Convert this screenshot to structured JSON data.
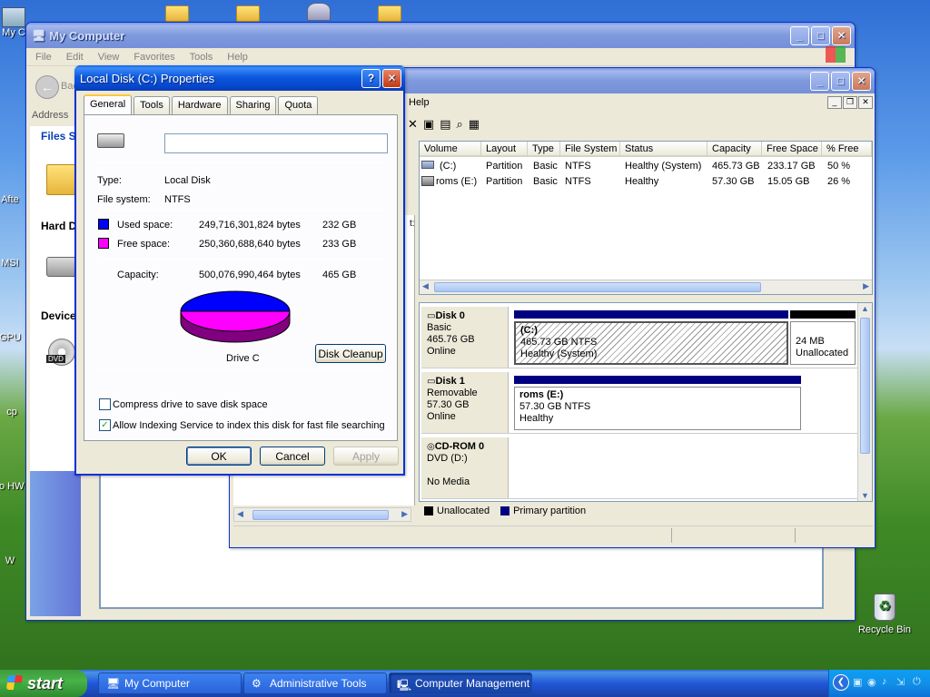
{
  "desktop": {
    "icons": [
      {
        "label": "My C",
        "name": "my-computer-icon"
      },
      {
        "label": "Afte",
        "name": "desktop-shortcut-icon"
      },
      {
        "label": "MSI",
        "name": "msi-icon"
      },
      {
        "label": "GPU",
        "name": "gpu-icon"
      },
      {
        "label": "cp",
        "name": "cp-icon"
      },
      {
        "label": "Sho HW",
        "name": "show-hw-icon"
      },
      {
        "label": "W",
        "name": "w-icon"
      }
    ],
    "recycle_bin": "Recycle Bin"
  },
  "my_computer": {
    "title": "My Computer",
    "menu": [
      "File",
      "Edit",
      "View",
      "Favorites",
      "Tools",
      "Help"
    ],
    "back_label": "Back",
    "address_label": "Address",
    "sections": [
      "Files S",
      "Hard D",
      "Device"
    ]
  },
  "comp_mgmt": {
    "menu_help": "Help",
    "columns": [
      "Volume",
      "Layout",
      "Type",
      "File System",
      "Status",
      "Capacity",
      "Free Space",
      "% Free"
    ],
    "volumes": [
      {
        "volume": "(C:)",
        "layout": "Partition",
        "type": "Basic",
        "fs": "NTFS",
        "status": "Healthy (System)",
        "capacity": "465.73 GB",
        "free": "233.17 GB",
        "pct": "50 %"
      },
      {
        "volume": "roms (E:)",
        "layout": "Partition",
        "type": "Basic",
        "fs": "NTFS",
        "status": "Healthy",
        "capacity": "57.30 GB",
        "free": "15.05 GB",
        "pct": "26 %"
      }
    ],
    "disks": [
      {
        "name": "Disk 0",
        "kind": "Basic",
        "size": "465.76 GB",
        "state": "Online",
        "part_label": "(C:)",
        "part_size": "465.73 GB NTFS",
        "part_status": "Healthy (System)",
        "unalloc_size": "24 MB",
        "unalloc_label": "Unallocated"
      },
      {
        "name": "Disk 1",
        "kind": "Removable",
        "size": "57.30 GB",
        "state": "Online",
        "part_label": "roms  (E:)",
        "part_size": "57.30 GB NTFS",
        "part_status": "Healthy"
      },
      {
        "name": "CD-ROM 0",
        "kind": "DVD (D:)",
        "size": "",
        "state": "No Media"
      }
    ],
    "legend": [
      "Unallocated",
      "Primary partition"
    ],
    "legend_colors": {
      "unallocated": "#000000",
      "primary": "#000080"
    }
  },
  "dialog": {
    "title": "Local Disk (C:) Properties",
    "tabs": [
      "General",
      "Tools",
      "Hardware",
      "Sharing",
      "Quota"
    ],
    "name_value": "",
    "type_label": "Type:",
    "type_value": "Local Disk",
    "fs_label": "File system:",
    "fs_value": "NTFS",
    "used_label": "Used space:",
    "used_bytes": "249,716,301,824 bytes",
    "used_gb": "232 GB",
    "free_label": "Free space:",
    "free_bytes": "250,360,688,640 bytes",
    "free_gb": "233 GB",
    "cap_label": "Capacity:",
    "cap_bytes": "500,076,990,464 bytes",
    "cap_gb": "465 GB",
    "drive_label": "Drive C",
    "cleanup": "Disk Cleanup",
    "compress": "Compress drive to save disk space",
    "compress_checked": false,
    "index": "Allow Indexing Service to index this disk for fast file searching",
    "index_checked": true,
    "ok": "OK",
    "cancel": "Cancel",
    "apply": "Apply",
    "colors": {
      "used": "#0000ff",
      "free": "#ff00ff"
    }
  },
  "taskbar": {
    "start": "start",
    "tasks": [
      "My Computer",
      "Administrative Tools",
      "Computer Management"
    ]
  }
}
